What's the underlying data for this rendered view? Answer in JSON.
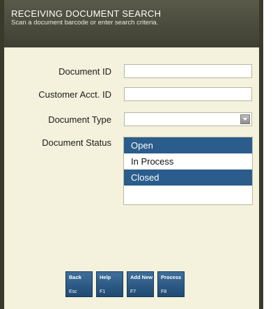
{
  "header": {
    "title": "RECEIVING DOCUMENT SEARCH",
    "subtitle": "Scan a document barcode or enter search criteria."
  },
  "form": {
    "document_id": {
      "label": "Document ID",
      "value": ""
    },
    "customer_acct_id": {
      "label": "Customer Acct. ID",
      "value": ""
    },
    "document_type": {
      "label": "Document Type",
      "value": ""
    },
    "document_status": {
      "label": "Document Status",
      "options": [
        "Open",
        "In Process",
        "Closed"
      ],
      "selected": [
        "Open",
        "Closed"
      ]
    }
  },
  "buttons": [
    {
      "name": "Back",
      "key": "Esc"
    },
    {
      "name": "Help",
      "key": "F1"
    },
    {
      "name": "Add New",
      "key": "F7"
    },
    {
      "name": "Process",
      "key": "F8"
    }
  ],
  "colors": {
    "background": "#f4f2dc",
    "header": "#4a4a3c",
    "selection": "#2a5d8c",
    "button": "#2e5f8a"
  }
}
